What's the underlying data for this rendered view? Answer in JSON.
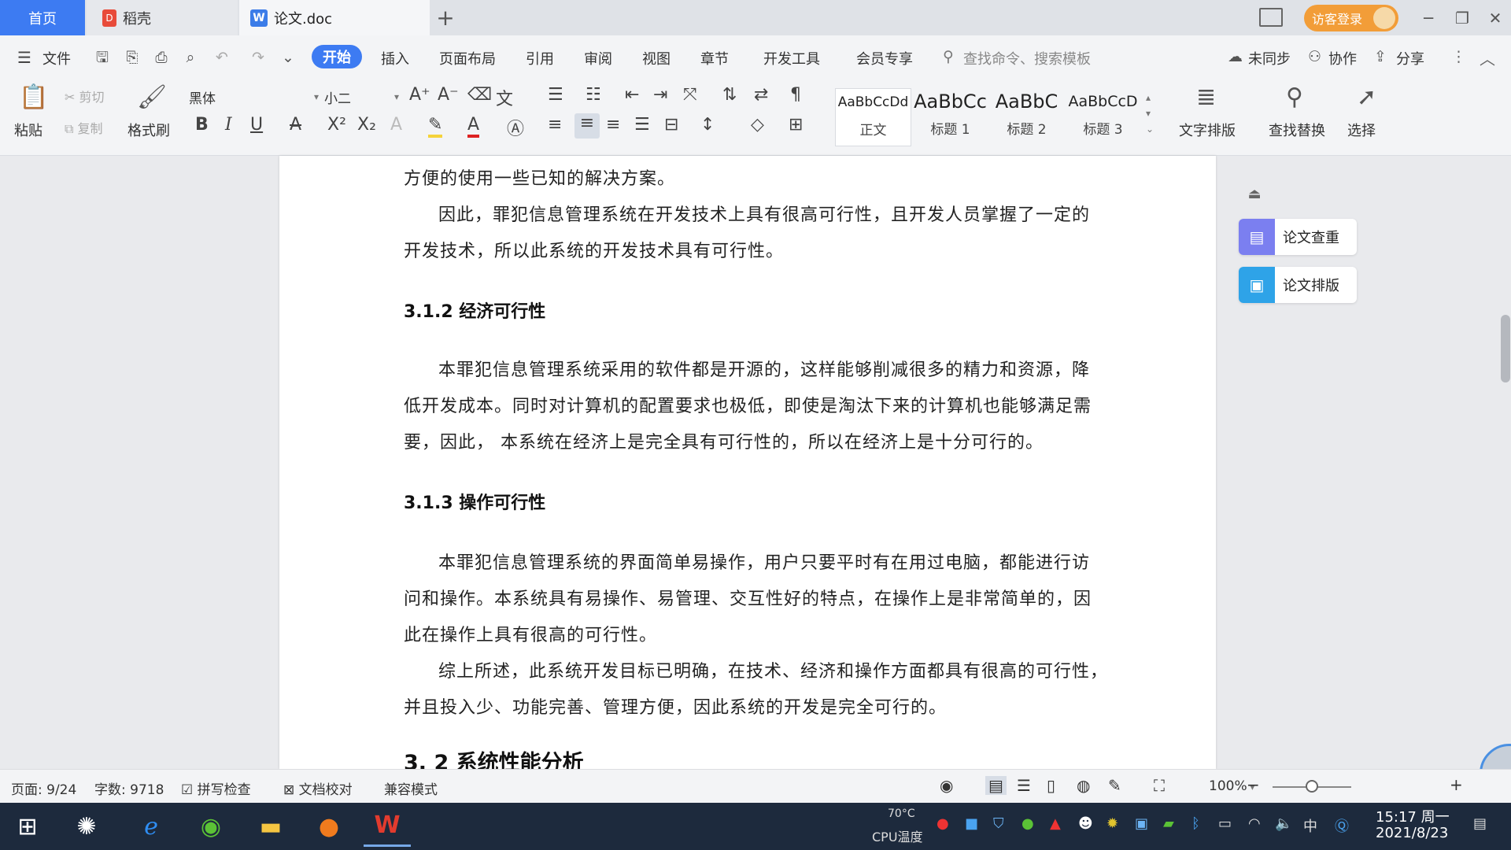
{
  "titlebar": {
    "tabs": [
      {
        "label": "首页"
      },
      {
        "label": "稻壳"
      },
      {
        "label": "论文.doc"
      }
    ],
    "new_tab": "+",
    "login": "访客登录"
  },
  "menubar": {
    "file": "文件",
    "items": [
      "开始",
      "插入",
      "页面布局",
      "引用",
      "审阅",
      "视图",
      "章节",
      "开发工具",
      "会员专享"
    ],
    "search": "查找命令、搜索模板",
    "sync": "未同步",
    "collab": "协作",
    "share": "分享"
  },
  "ribbon": {
    "paste": "粘贴",
    "cut": "剪切",
    "copy": "复制",
    "format_painter": "格式刷",
    "font_name": "黑体",
    "font_size": "小二",
    "styles": [
      {
        "sample": "AaBbCcDd",
        "name": "正文"
      },
      {
        "sample": "AaBbCc",
        "name": "标题 1"
      },
      {
        "sample": "AaBbC",
        "name": "标题 2"
      },
      {
        "sample": "AaBbCcD",
        "name": "标题 3"
      }
    ],
    "text_layout": "文字排版",
    "find_replace": "查找替换",
    "select": "选择"
  },
  "document": {
    "p0": "方便的使用一些已知的解决方案。",
    "p1": [
      "因此，罪犯信息管理系统在开发技术上具有很高可行性，且开发人员掌握了一定的",
      "开发技术，所以此系统的开发技术具有可行性。"
    ],
    "h312": "3.1.2 经济可行性",
    "p2": [
      "本罪犯信息管理系统采用的软件都是开源的，这样能够削减很多的精力和资源，降",
      "低开发成本。同时对计算机的配置要求也极低，即使是淘汰下来的计算机也能够满足需",
      "要，因此， 本系统在经济上是完全具有可行性的，所以在经济上是十分可行的。"
    ],
    "h313": "3.1.3 操作可行性",
    "p3": [
      "本罪犯信息管理系统的界面简单易操作，用户只要平时有在用过电脑，都能进行访",
      "问和操作。本系统具有易操作、易管理、交互性好的特点，在操作上是非常简单的，因",
      "此在操作上具有很高的可行性。"
    ],
    "p4": [
      "综上所述，此系统开发目标已明确，在技术、经济和操作方面都具有很高的可行性，",
      "并且投入少、功能完善、管理方便，因此系统的开发是完全可行的。"
    ],
    "h32": "3. 2 系统性能分析"
  },
  "side_panel": {
    "check": "论文查重",
    "layout": "论文排版"
  },
  "statusbar": {
    "page": "页面: 9/24",
    "words": "字数: 9718",
    "spell": "拼写检查",
    "proof": "文档校对",
    "compat": "兼容模式",
    "zoom": "100%",
    "zoom_level": 0.5
  },
  "taskbar": {
    "cpu_temp": "70°C",
    "cpu_label": "CPU温度",
    "ime": "中",
    "time": "15:17 周一",
    "date": "2021/8/23"
  },
  "colors": {
    "accent": "#3d7bf2",
    "login": "#f29d38",
    "taskbar": "#1d2a3d"
  }
}
